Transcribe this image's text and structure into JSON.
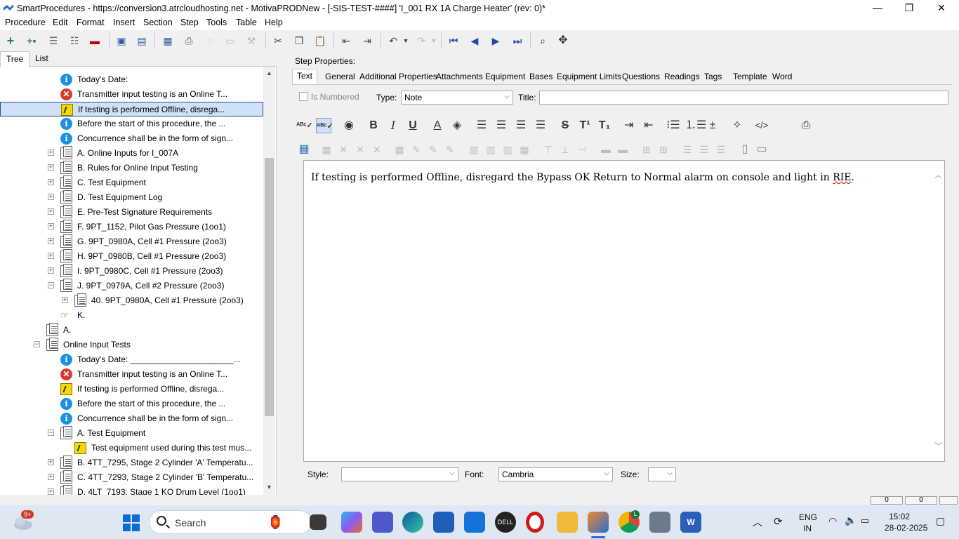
{
  "window": {
    "title": "SmartProcedures - https://conversion3.atrcloudhosting.net - MotivaPRODNew - [-SIS-TEST-####] 'I_001 RX 1A Charge Heater' (rev: 0)*",
    "minimize": "—",
    "maximize": "❐",
    "close": "✕"
  },
  "menu": [
    "Procedure",
    "Edit",
    "Format",
    "Insert",
    "Section",
    "Step",
    "Tools",
    "Table",
    "Help"
  ],
  "left_tabs": {
    "tree": "Tree",
    "list": "List"
  },
  "tree": [
    {
      "indent": 3,
      "icon": "info",
      "label": "Today's Date:",
      "expander": ""
    },
    {
      "indent": 3,
      "icon": "err",
      "label": "Transmitter input testing is an Online T...",
      "expander": ""
    },
    {
      "indent": 3,
      "icon": "note",
      "label": "If testing is performed Offline, disrega...",
      "expander": "",
      "selected": true
    },
    {
      "indent": 3,
      "icon": "info",
      "label": "Before the start of this procedure, the ...",
      "expander": ""
    },
    {
      "indent": 3,
      "icon": "info",
      "label": "Concurrence shall be in the form of sign...",
      "expander": ""
    },
    {
      "indent": 3,
      "icon": "doc",
      "label": "A. Online Inputs for I_007A",
      "expander": "+"
    },
    {
      "indent": 3,
      "icon": "doc",
      "label": "B. Rules for Online Input Testing",
      "expander": "+"
    },
    {
      "indent": 3,
      "icon": "doc",
      "label": "C. Test Equipment",
      "expander": "+"
    },
    {
      "indent": 3,
      "icon": "doc",
      "label": "D. Test Equipment Log",
      "expander": "+"
    },
    {
      "indent": 3,
      "icon": "doc",
      "label": "E. Pre-Test Signature Requirements",
      "expander": "+"
    },
    {
      "indent": 3,
      "icon": "doc",
      "label": "F. 9PT_1152, Pilot Gas Pressure (1oo1)",
      "expander": "+"
    },
    {
      "indent": 3,
      "icon": "doc",
      "label": "G. 9PT_0980A, Cell #1 Pressure (2oo3)",
      "expander": "+"
    },
    {
      "indent": 3,
      "icon": "doc",
      "label": "H. 9PT_0980B, Cell #1 Pressure (2oo3)",
      "expander": "+"
    },
    {
      "indent": 3,
      "icon": "doc",
      "label": "I. 9PT_0980C, Cell #1 Pressure (2oo3)",
      "expander": "+"
    },
    {
      "indent": 3,
      "icon": "doc",
      "label": "J. 9PT_0979A, Cell #2 Pressure (2oo3)",
      "expander": "−"
    },
    {
      "indent": 4,
      "icon": "doc",
      "label": "40. 9PT_0980A, Cell #1 Pressure (2oo3)",
      "expander": "+"
    },
    {
      "indent": 3,
      "icon": "hand",
      "label": "K.",
      "expander": ""
    },
    {
      "indent": 2,
      "icon": "doc",
      "label": "A.",
      "expander": ""
    },
    {
      "indent": 2,
      "icon": "doc",
      "label": "Online Input Tests",
      "expander": "−"
    },
    {
      "indent": 3,
      "icon": "info",
      "label": "Today's Date: ______________________...",
      "expander": ""
    },
    {
      "indent": 3,
      "icon": "err",
      "label": "Transmitter input testing is an Online T...",
      "expander": ""
    },
    {
      "indent": 3,
      "icon": "note",
      "label": "If testing is performed Offline, disrega...",
      "expander": ""
    },
    {
      "indent": 3,
      "icon": "info",
      "label": "Before the start of this procedure, the ...",
      "expander": ""
    },
    {
      "indent": 3,
      "icon": "info",
      "label": "Concurrence shall be in the form of sign...",
      "expander": ""
    },
    {
      "indent": 3,
      "icon": "doc",
      "label": "A. Test Equipment",
      "expander": "−"
    },
    {
      "indent": 4,
      "icon": "note",
      "label": "Test equipment used during this test mus...",
      "expander": ""
    },
    {
      "indent": 3,
      "icon": "doc",
      "label": "B. 4TT_7295, Stage 2 Cylinder 'A' Temperatu...",
      "expander": "+"
    },
    {
      "indent": 3,
      "icon": "doc",
      "label": "C. 4TT_7293, Stage 2 Cylinder 'B' Temperatu...",
      "expander": "+"
    },
    {
      "indent": 3,
      "icon": "doc",
      "label": "D. 4LT_7193, Stage 1 KO Drum Level (1oo1)",
      "expander": "+"
    }
  ],
  "step_properties": {
    "label": "Step Properties:",
    "tabs": [
      "Text",
      "General",
      "Additional Properties",
      "Attachments",
      "Equipment",
      "Bases",
      "Equipment Limits",
      "Questions",
      "Readings",
      "Tags",
      "Template",
      "Word"
    ],
    "is_numbered_label": "Is Numbered",
    "type_label": "Type:",
    "type_value": "Note",
    "title_label": "Title:",
    "title_value": ""
  },
  "editor": {
    "text_main": "If testing is performed Offline, disregard the Bypass OK Return to Normal alarm on console and light in ",
    "text_misspelled": "RIE",
    "text_end": "."
  },
  "bottom": {
    "style_label": "Style:",
    "style_value": "",
    "font_label": "Font:",
    "font_value": "Cambria",
    "size_label": "Size:",
    "size_value": ""
  },
  "status": {
    "box1": "0",
    "box2": "0"
  },
  "taskbar": {
    "search_label": "Search",
    "weather_badge": "9+",
    "lang_top": "ENG",
    "lang_bottom": "IN",
    "time": "15:02",
    "date": "28-02-2025",
    "chrome_badge": "L"
  }
}
